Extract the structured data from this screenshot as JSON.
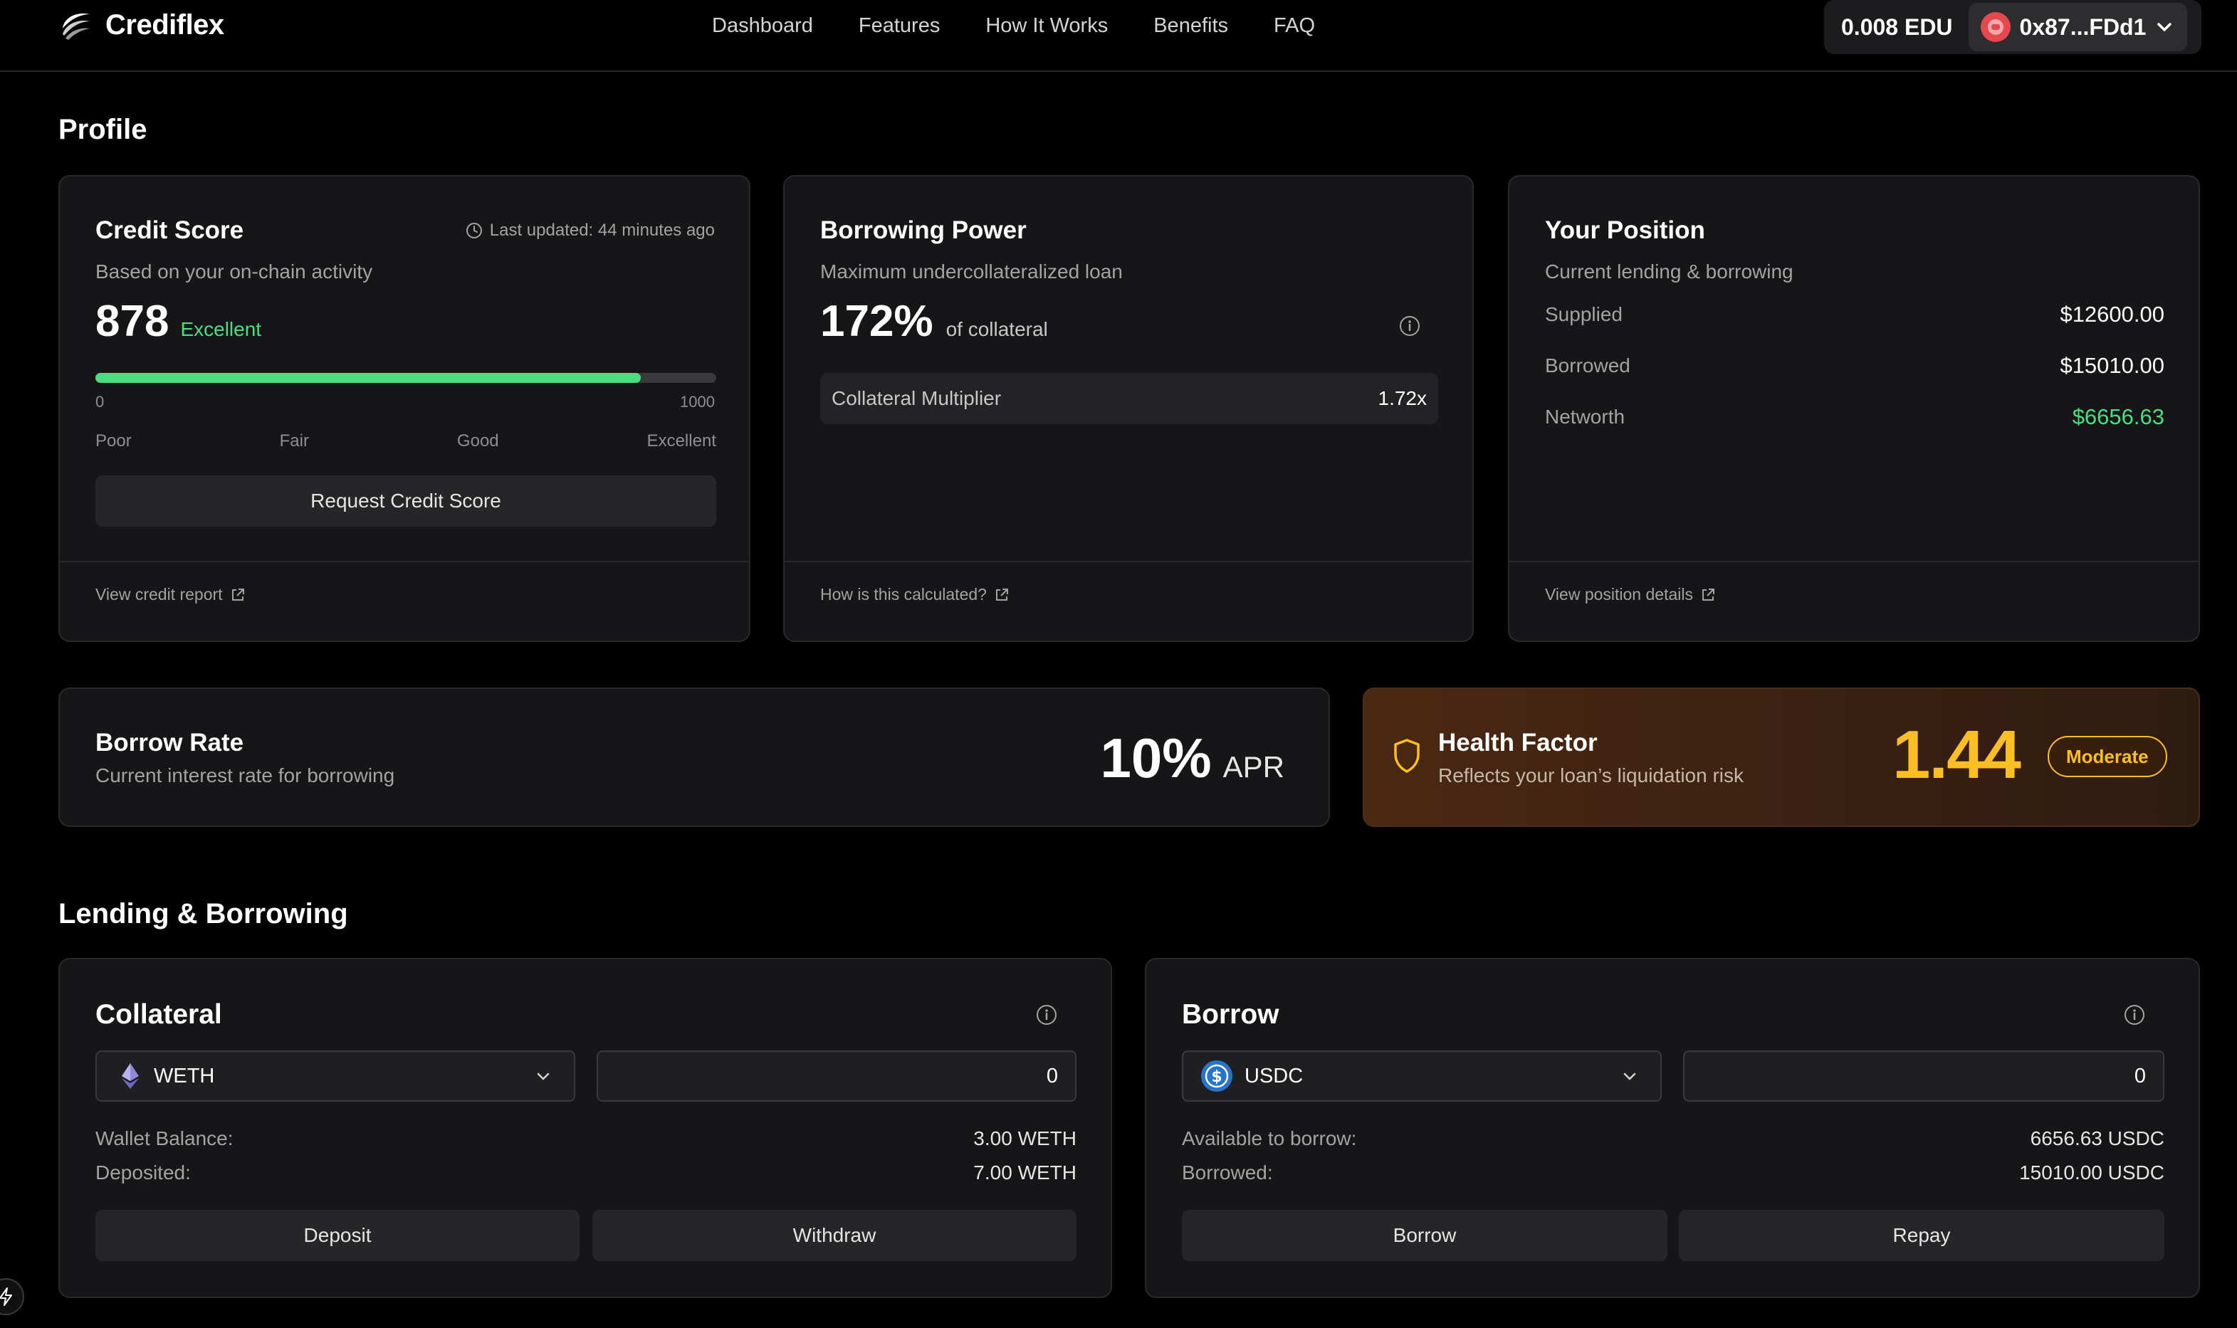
{
  "brand": {
    "name": "Crediflex",
    "logo_icon": "crediflex-logo-icon"
  },
  "nav": {
    "items": [
      "Dashboard",
      "Features",
      "How It Works",
      "Benefits",
      "FAQ"
    ]
  },
  "wallet": {
    "balance": "0.008 EDU",
    "address": "0x87...FDd1",
    "avatar_icon": "wallet-avatar-icon"
  },
  "profile": {
    "title": "Profile",
    "credit_score": {
      "title": "Credit Score",
      "last_updated": "Last updated: 44 minutes ago",
      "subtitle": "Based on your on-chain activity",
      "score": "878",
      "rating": "Excellent",
      "progress": 0.878,
      "scale_min": "0",
      "scale_max": "1000",
      "levels": [
        "Poor",
        "Fair",
        "Good",
        "Excellent"
      ],
      "button": "Request Credit Score",
      "link": "View credit report",
      "accent": "#4ade80"
    },
    "borrowing_power": {
      "title": "Borrowing Power",
      "subtitle": "Maximum undercollateralized loan",
      "value": "172%",
      "value_suffix": "of collateral",
      "multiplier_label": "Collateral Multiplier",
      "multiplier_value": "1.72x",
      "link": "How is this calculated?"
    },
    "position": {
      "title": "Your Position",
      "subtitle": "Current lending & borrowing",
      "rows": [
        {
          "label": "Supplied",
          "value": "$12600.00"
        },
        {
          "label": "Borrowed",
          "value": "$15010.00"
        },
        {
          "label": "Networth",
          "value": "$6656.63"
        }
      ],
      "networth_color": "#4ade80",
      "link": "View position details"
    },
    "borrow_rate": {
      "title": "Borrow Rate",
      "subtitle": "Current interest rate for borrowing",
      "value": "10%",
      "unit": "APR"
    },
    "health_factor": {
      "title": "Health Factor",
      "subtitle": "Reflects your loan’s liquidation risk",
      "value": "1.44",
      "badge": "Moderate",
      "color": "#fbbf24"
    }
  },
  "lending": {
    "title": "Lending & Borrowing",
    "collateral": {
      "title": "Collateral",
      "token": "WETH",
      "token_icon": "ethereum-icon",
      "amount": "0",
      "rows": [
        {
          "label": "Wallet Balance:",
          "value": "3.00 WETH"
        },
        {
          "label": "Deposited:",
          "value": "7.00 WETH"
        }
      ],
      "buttons": [
        "Deposit",
        "Withdraw"
      ]
    },
    "borrow": {
      "title": "Borrow",
      "token": "USDC",
      "token_icon": "usdc-icon",
      "amount": "0",
      "rows": [
        {
          "label": "Available to borrow:",
          "value": "6656.63 USDC"
        },
        {
          "label": "Borrowed:",
          "value": "15010.00 USDC"
        }
      ],
      "buttons": [
        "Borrow",
        "Repay"
      ]
    }
  }
}
